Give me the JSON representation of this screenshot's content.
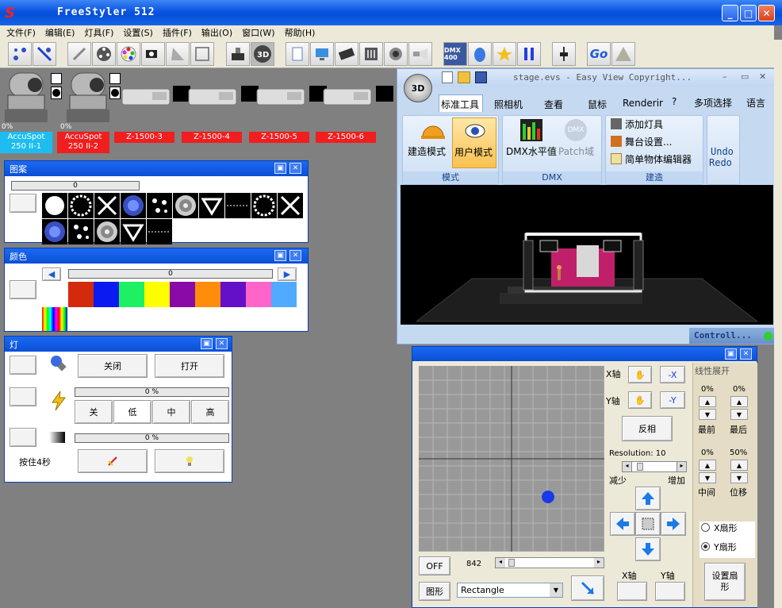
{
  "window": {
    "title": "FreeStyler 512",
    "min": "_",
    "max": "□",
    "close": "✕"
  },
  "menu": [
    "文件(F)",
    "编辑(E)",
    "灯具(F)",
    "设置(S)",
    "插件(F)",
    "输出(O)",
    "窗口(W)",
    "帮助(H)"
  ],
  "toolbar": {
    "dmx_label": "DMX 400",
    "go_label": "Go"
  },
  "fixtures": [
    {
      "name": "AccuSpot 250 II-1",
      "percent": "0%",
      "color": "#1ebdf0",
      "type": "moving-head"
    },
    {
      "name": "AccuSpot 250 II-2",
      "percent": "0%",
      "color": "#f01e1e",
      "type": "moving-head"
    },
    {
      "name": "Z-1500-3",
      "color": "#f01e1e",
      "type": "fog"
    },
    {
      "name": "Z-1500-4",
      "color": "#f01e1e",
      "type": "fog"
    },
    {
      "name": "Z-1500-5",
      "color": "#f01e1e",
      "type": "fog"
    },
    {
      "name": "Z-1500-6",
      "color": "#f01e1e",
      "type": "fog"
    }
  ],
  "gobo_panel": {
    "title": "图案",
    "slider_value": "0"
  },
  "color_panel": {
    "title": "颜色",
    "slider_value": "0",
    "swatches": [
      "#d42a0c",
      "#0a1af0",
      "#1ef064",
      "#ffff00",
      "#8a0aa8",
      "#ff8c0a",
      "#6410c8",
      "#ff64c8",
      "#50aaff"
    ]
  },
  "lamp_panel": {
    "title": "灯",
    "off_button": "关闭",
    "on_button": "打开",
    "shutter_value": "0 %",
    "shutter_buttons": [
      "关",
      "低",
      "中",
      "高"
    ],
    "dimmer_value": "0 %",
    "hold_label": "按住4秒"
  },
  "viewer": {
    "title": "stage.evs - Easy View   Copyright...",
    "tabs": [
      "标准工具",
      "照相机",
      "查看",
      "鼠标",
      "Renderir"
    ],
    "help": "?",
    "multi_select": "多项选择",
    "language": "语言",
    "mode_group": {
      "label": "模式",
      "build": "建造模式",
      "user": "用户模式"
    },
    "dmx_group": {
      "label": "DMX",
      "level": "DMX水平值",
      "patch": "Patch域"
    },
    "build_group": {
      "label": "建造",
      "add": "添加灯具",
      "stage": "舞台设置...",
      "editor": "简单物体编辑器"
    },
    "undo": "Undo",
    "redo": "Redo",
    "status": "Controll..."
  },
  "xy_panel": {
    "x_axis": "X轴",
    "y_axis": "Y轴",
    "minus_x": "-X",
    "minus_y": "-Y",
    "invert": "反相",
    "resolution_label": "Resolution: 10",
    "decrease": "减少",
    "increase": "增加",
    "off_button": "OFF",
    "position_value": "842",
    "shape_button": "图形",
    "shape_select": "Rectangle",
    "x_axis_bottom": "X轴",
    "y_axis_bottom": "Y轴",
    "spread_title": "线性展开",
    "first_pct": "0%",
    "last_pct": "0%",
    "first": "最前",
    "last": "最后",
    "middle_pct": "0%",
    "offset_pct": "50%",
    "middle": "中间",
    "offset": "位移",
    "x_fan": "X扇形",
    "y_fan": "Y扇形",
    "set_fan": "设置扇形"
  }
}
